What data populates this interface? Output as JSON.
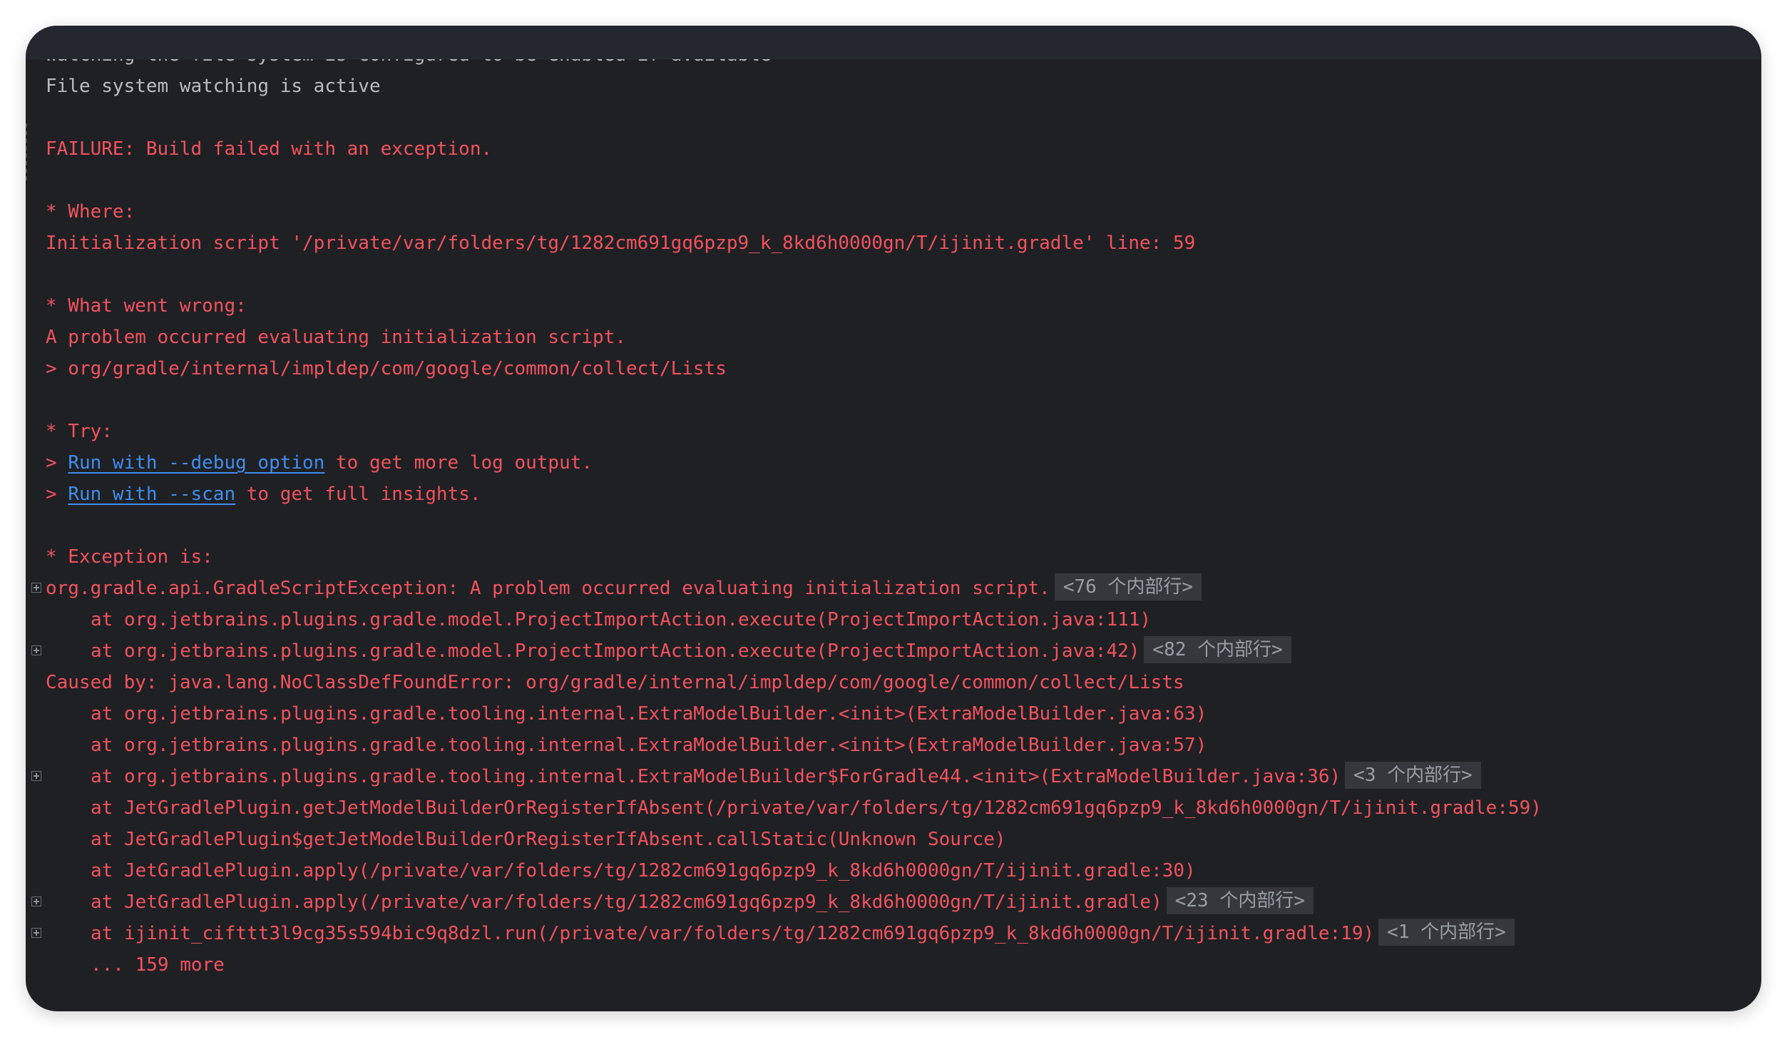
{
  "console": {
    "lines": [
      {
        "type": "plain",
        "text": "Watching the file system is configured to be enabled if available"
      },
      {
        "type": "plain",
        "text": "File system watching is active"
      },
      {
        "type": "blank"
      },
      {
        "type": "error",
        "text": "FAILURE: Build failed with an exception."
      },
      {
        "type": "blank"
      },
      {
        "type": "error",
        "text": "* Where:"
      },
      {
        "type": "error",
        "text": "Initialization script '/private/var/folders/tg/1282cm691gq6pzp9_k_8kd6h0000gn/T/ijinit.gradle' line: 59"
      },
      {
        "type": "blank"
      },
      {
        "type": "error",
        "text": "* What went wrong:"
      },
      {
        "type": "error",
        "text": "A problem occurred evaluating initialization script."
      },
      {
        "type": "error",
        "text": "> org/gradle/internal/impldep/com/google/common/collect/Lists"
      },
      {
        "type": "blank"
      },
      {
        "type": "error",
        "text": "* Try:"
      },
      {
        "type": "link",
        "prefix": "> ",
        "link": "Run with --debug option",
        "suffix": " to get more log output."
      },
      {
        "type": "link",
        "prefix": "> ",
        "link": "Run with --scan",
        "suffix": " to get full insights."
      },
      {
        "type": "blank"
      },
      {
        "type": "error",
        "text": "* Exception is:"
      },
      {
        "type": "error",
        "text": "org.gradle.api.GradleScriptException: A problem occurred evaluating initialization script.",
        "fold": "<76 个内部行>",
        "expandable": true
      },
      {
        "type": "error",
        "indent": true,
        "text": "at org.jetbrains.plugins.gradle.model.ProjectImportAction.execute(ProjectImportAction.java:111)"
      },
      {
        "type": "error",
        "indent": true,
        "text": "at org.jetbrains.plugins.gradle.model.ProjectImportAction.execute(ProjectImportAction.java:42)",
        "fold": "<82 个内部行>",
        "expandable": true
      },
      {
        "type": "error",
        "text": "Caused by: java.lang.NoClassDefFoundError: org/gradle/internal/impldep/com/google/common/collect/Lists"
      },
      {
        "type": "error",
        "indent": true,
        "text": "at org.jetbrains.plugins.gradle.tooling.internal.ExtraModelBuilder.<init>(ExtraModelBuilder.java:63)"
      },
      {
        "type": "error",
        "indent": true,
        "text": "at org.jetbrains.plugins.gradle.tooling.internal.ExtraModelBuilder.<init>(ExtraModelBuilder.java:57)"
      },
      {
        "type": "error",
        "indent": true,
        "text": "at org.jetbrains.plugins.gradle.tooling.internal.ExtraModelBuilder$ForGradle44.<init>(ExtraModelBuilder.java:36)",
        "fold": "<3 个内部行>",
        "expandable": true
      },
      {
        "type": "error",
        "indent": true,
        "text": "at JetGradlePlugin.getJetModelBuilderOrRegisterIfAbsent(/private/var/folders/tg/1282cm691gq6pzp9_k_8kd6h0000gn/T/ijinit.gradle:59)"
      },
      {
        "type": "error",
        "indent": true,
        "text": "at JetGradlePlugin$getJetModelBuilderOrRegisterIfAbsent.callStatic(Unknown Source)"
      },
      {
        "type": "error",
        "indent": true,
        "text": "at JetGradlePlugin.apply(/private/var/folders/tg/1282cm691gq6pzp9_k_8kd6h0000gn/T/ijinit.gradle:30)"
      },
      {
        "type": "error",
        "indent": true,
        "text": "at JetGradlePlugin.apply(/private/var/folders/tg/1282cm691gq6pzp9_k_8kd6h0000gn/T/ijinit.gradle)",
        "fold": "<23 个内部行>",
        "expandable": true
      },
      {
        "type": "error",
        "indent": true,
        "text": "at ijinit_cifttt3l9cg35s594bic9q8dzl.run(/private/var/folders/tg/1282cm691gq6pzp9_k_8kd6h0000gn/T/ijinit.gradle:19)",
        "fold": "<1 个内部行>",
        "expandable": true
      },
      {
        "type": "error",
        "indent": true,
        "text": "... 159 more"
      }
    ]
  },
  "colors": {
    "background": "#1f2023",
    "error_text": "#f2525f",
    "plain_text": "#b9bcc1",
    "link_text": "#3e8ef0",
    "fold_bg": "#35373c"
  },
  "icons": {
    "expand": "plus-square-icon"
  }
}
